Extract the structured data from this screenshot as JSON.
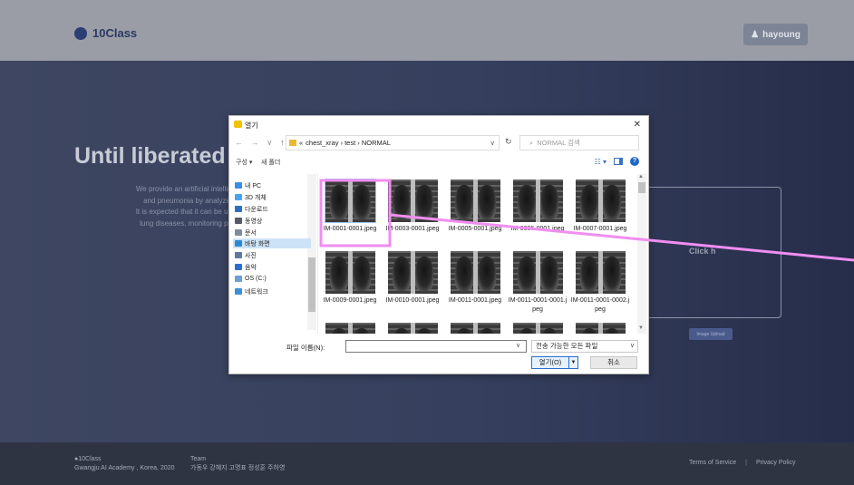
{
  "site": {
    "brand": "10Class",
    "user_button": "hayoung",
    "hero_title": "Until liberated f",
    "hero_desc": [
      "We provide an artificial intellige",
      "and pneumonia by analyzing",
      "It is expected that it can be use",
      "lung diseases, monitoring pati"
    ],
    "upload_box_label": "Click h",
    "upload_button": "Image Upload",
    "footer": {
      "brand": "10Class",
      "address": "Gwangju AI Academy , Korea, 2020",
      "team_label": "Team",
      "team_members": "가동우  강혜지  고명표  정성훈  주하영",
      "terms": "Terms of Service",
      "separator": "|",
      "privacy": "Privacy Policy"
    }
  },
  "dialog": {
    "title": "열기",
    "close": "✕",
    "nav_arrows": "← → ∨",
    "nav_up": "↑",
    "address_prefix": "«",
    "address_path": "chest_xray › test › NORMAL",
    "address_dropdown": "∨",
    "refresh": "↻",
    "search_icon": "⌕",
    "search_placeholder": "NORMAL 검색",
    "toolbar": {
      "organize": "구성 ▾",
      "new_folder": "새 폴더",
      "view": "☷ ▾",
      "help": "?"
    },
    "sidebar": [
      {
        "label": "내 PC",
        "icon": "computer-icon",
        "color": "#3a8ee6"
      },
      {
        "label": "3D 개체",
        "icon": "cube-icon",
        "color": "#4aa3f0"
      },
      {
        "label": "다운로드",
        "icon": "download-icon",
        "color": "#2f6fbf"
      },
      {
        "label": "동영상",
        "icon": "video-icon",
        "color": "#555b66"
      },
      {
        "label": "문서",
        "icon": "document-icon",
        "color": "#7f8c9c"
      },
      {
        "label": "바탕 화면",
        "icon": "desktop-icon",
        "color": "#2e88d8"
      },
      {
        "label": "사진",
        "icon": "pictures-icon",
        "color": "#5d7aa1"
      },
      {
        "label": "음악",
        "icon": "music-icon",
        "color": "#2a6fcf"
      },
      {
        "label": "OS (C:)",
        "icon": "drive-icon",
        "color": "#6d9fd6"
      },
      {
        "label": "네트워크",
        "icon": "network-icon",
        "color": "#3c8ed8"
      }
    ],
    "files": [
      {
        "name": "IM-0001-0001.jpeg"
      },
      {
        "name": "IM-0003-0001.jpeg"
      },
      {
        "name": "IM-0005-0001.jpeg"
      },
      {
        "name": "IM-0006-0001.jpeg"
      },
      {
        "name": "IM-0007-0001.jpeg"
      },
      {
        "name": "IM-0009-0001.jpeg"
      },
      {
        "name": "IM-0010-0001.jpeg"
      },
      {
        "name": "IM-0011-0001.jpeg"
      },
      {
        "name": "IM-0011-0001-0001.jpeg"
      },
      {
        "name": "IM-0011-0001-0002.jpeg"
      }
    ],
    "filename_label": "파일 이름(N):",
    "filename_value": "",
    "filetype": "전송 가능한 모든 파일",
    "dropdown_arrow": "∨",
    "open_button": "열기(O)",
    "open_split": "▼",
    "cancel_button": "취소"
  },
  "colors": {
    "annotation": "#f08ef0",
    "accent": "#2a6fcf"
  }
}
